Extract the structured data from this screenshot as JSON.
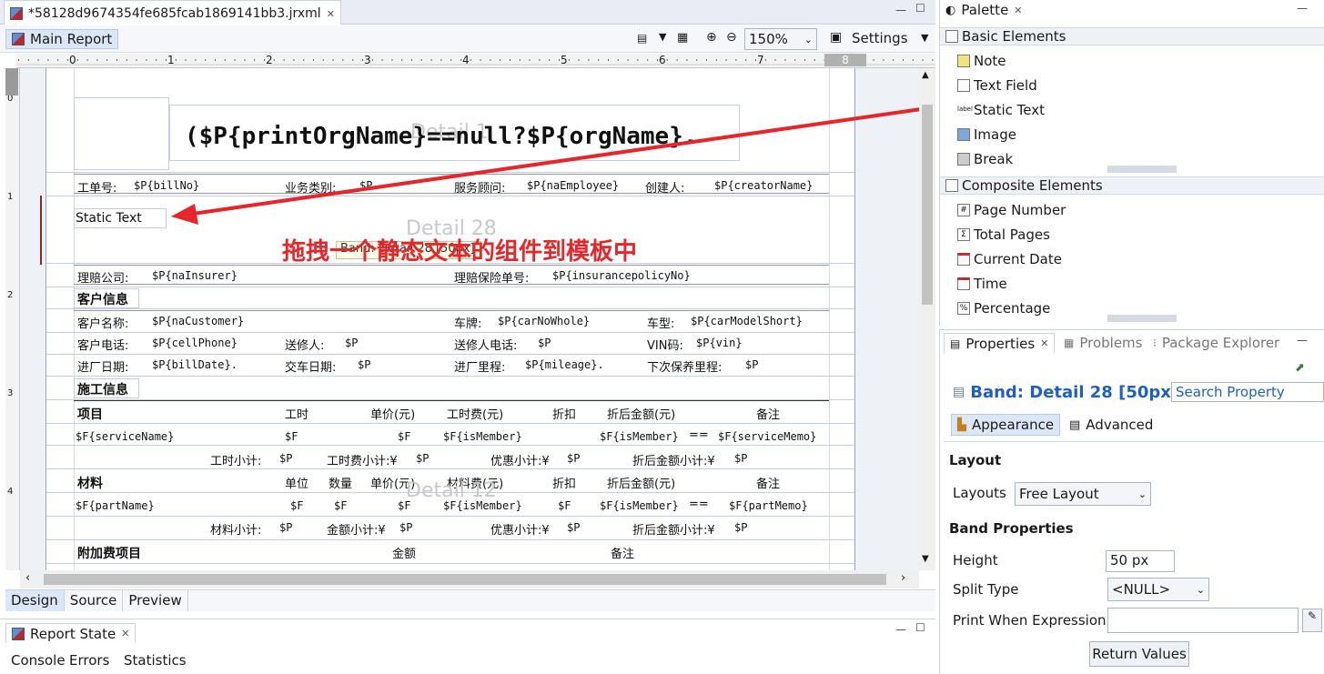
{
  "editor": {
    "tab_title": "*58128d9674354fe685fcab1869141bb3.jrxml",
    "main_report": "Main Report",
    "zoom": "150%",
    "settings": "Settings"
  },
  "ruler": {
    "marks": [
      "0",
      "1",
      "2",
      "3",
      "4",
      "5",
      "6",
      "7",
      "8"
    ],
    "vmarks": [
      "0",
      "1",
      "2",
      "3",
      "4"
    ]
  },
  "report": {
    "title_expr": "($P{printOrgName}==null?$P{orgName}.",
    "band_detail1": "Detail 1",
    "band_detail28": "Detail 28",
    "band_detail12": "Detail 12",
    "band_tag": "Band: Detail 28 [50px]",
    "static_text": "Static Text",
    "annotation": "拖拽一个静态文本的组件到模板中",
    "row1": [
      "工单号:",
      "$P{billNo}",
      "业务类别:",
      "$P",
      "服务顾问:",
      "$P{naEmployee}",
      "创建人:",
      "$P{creatorName}"
    ],
    "row2": [
      "理赔公司:",
      "$P{naInsurer}",
      "理赔保险单号:",
      "$P{insurancepolicyNo}"
    ],
    "sec_customer": "客户信息",
    "row3": [
      "客户名称:",
      "$P{naCustomer}",
      "车牌:",
      "$P{carNoWhole}",
      "车型:",
      "$P{carModelShort}"
    ],
    "row4": [
      "客户电话:",
      "$P{cellPhone}",
      "送修人:",
      "$P",
      "送修人电话:",
      "$P",
      "VIN码:",
      "$P{vin}"
    ],
    "row5": [
      "进厂日期:",
      "$P{billDate}.",
      "交车日期:",
      "$P",
      "进厂里程:",
      "$P{mileage}.",
      "下次保养里程:",
      "$P"
    ],
    "sec_work": "施工信息",
    "hdr1": [
      "项目",
      "工时",
      "单价(元)",
      "工时费(元)",
      "折扣",
      "折后金额(元)",
      "备注"
    ],
    "row6": [
      "$F{serviceName}",
      "$F",
      "$F",
      "$F{isMember}",
      "$F{isMember}",
      "==",
      "$F{serviceMemo}"
    ],
    "row7": [
      "工时小计:",
      "$P",
      "工时费小计:¥",
      "$P",
      "优惠小计:¥",
      "$P",
      "折后金额小计:¥",
      "$P"
    ],
    "hdr2": [
      "材料",
      "单位",
      "数量",
      "单价(元)",
      "材料费(元)",
      "折扣",
      "折后金额(元)",
      "备注"
    ],
    "row8": [
      "$F{partName}",
      "$F",
      "$F",
      "$F",
      "$F{isMember}",
      "$F",
      "$F{isMember}",
      "==",
      "$F{partMemo}"
    ],
    "row9": [
      "材料小计:",
      "$P",
      "金额小计:¥",
      "$P",
      "优惠小计:¥",
      "$P",
      "折后金额小计:¥",
      "$P"
    ],
    "hdr3": [
      "附加费项目",
      "金额",
      "备注"
    ]
  },
  "bottom_tabs": [
    "Design",
    "Source",
    "Preview"
  ],
  "report_state": {
    "title": "Report State",
    "tabs": [
      "Console",
      "Errors",
      "Statistics"
    ]
  },
  "palette": {
    "title": "Palette",
    "basic": "Basic Elements",
    "basic_items": [
      "Note",
      "Text Field",
      "Static Text",
      "Image",
      "Break"
    ],
    "composite": "Composite Elements",
    "composite_items": [
      "Page Number",
      "Total Pages",
      "Current Date",
      "Time",
      "Percentage"
    ]
  },
  "properties": {
    "tabs": [
      "Properties",
      "Problems",
      "Package Explorer"
    ],
    "band_title": "Band: Detail 28 [50px]",
    "search_placeholder": "Search Property",
    "subtabs": [
      "Appearance",
      "Advanced"
    ],
    "layout_section": "Layout",
    "layouts_label": "Layouts",
    "layouts_value": "Free Layout",
    "band_section": "Band Properties",
    "height_label": "Height",
    "height_value": "50 px",
    "split_label": "Split Type",
    "split_value": "<NULL>",
    "print_when_label": "Print When Expression",
    "return_values": "Return Values"
  },
  "colors": {
    "accent": "#1f5fbf",
    "annotation_red": "#e5262b"
  }
}
